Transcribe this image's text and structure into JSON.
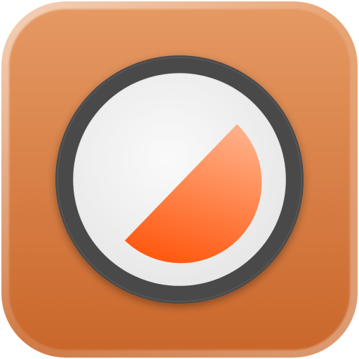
{
  "icon": {
    "name": "half-moon-dial-app-icon",
    "colors": {
      "tile_top": "#E69A64",
      "tile_bottom": "#C9662A",
      "tile_rim": "#F2B286",
      "ring": "#4A4A4A",
      "ring_highlight": "#5E5E5E",
      "face": "#FAFAFA",
      "face_edge": "#E6E6E6",
      "wedge_top": "#FFB088",
      "wedge_bottom": "#FF5A12"
    }
  }
}
